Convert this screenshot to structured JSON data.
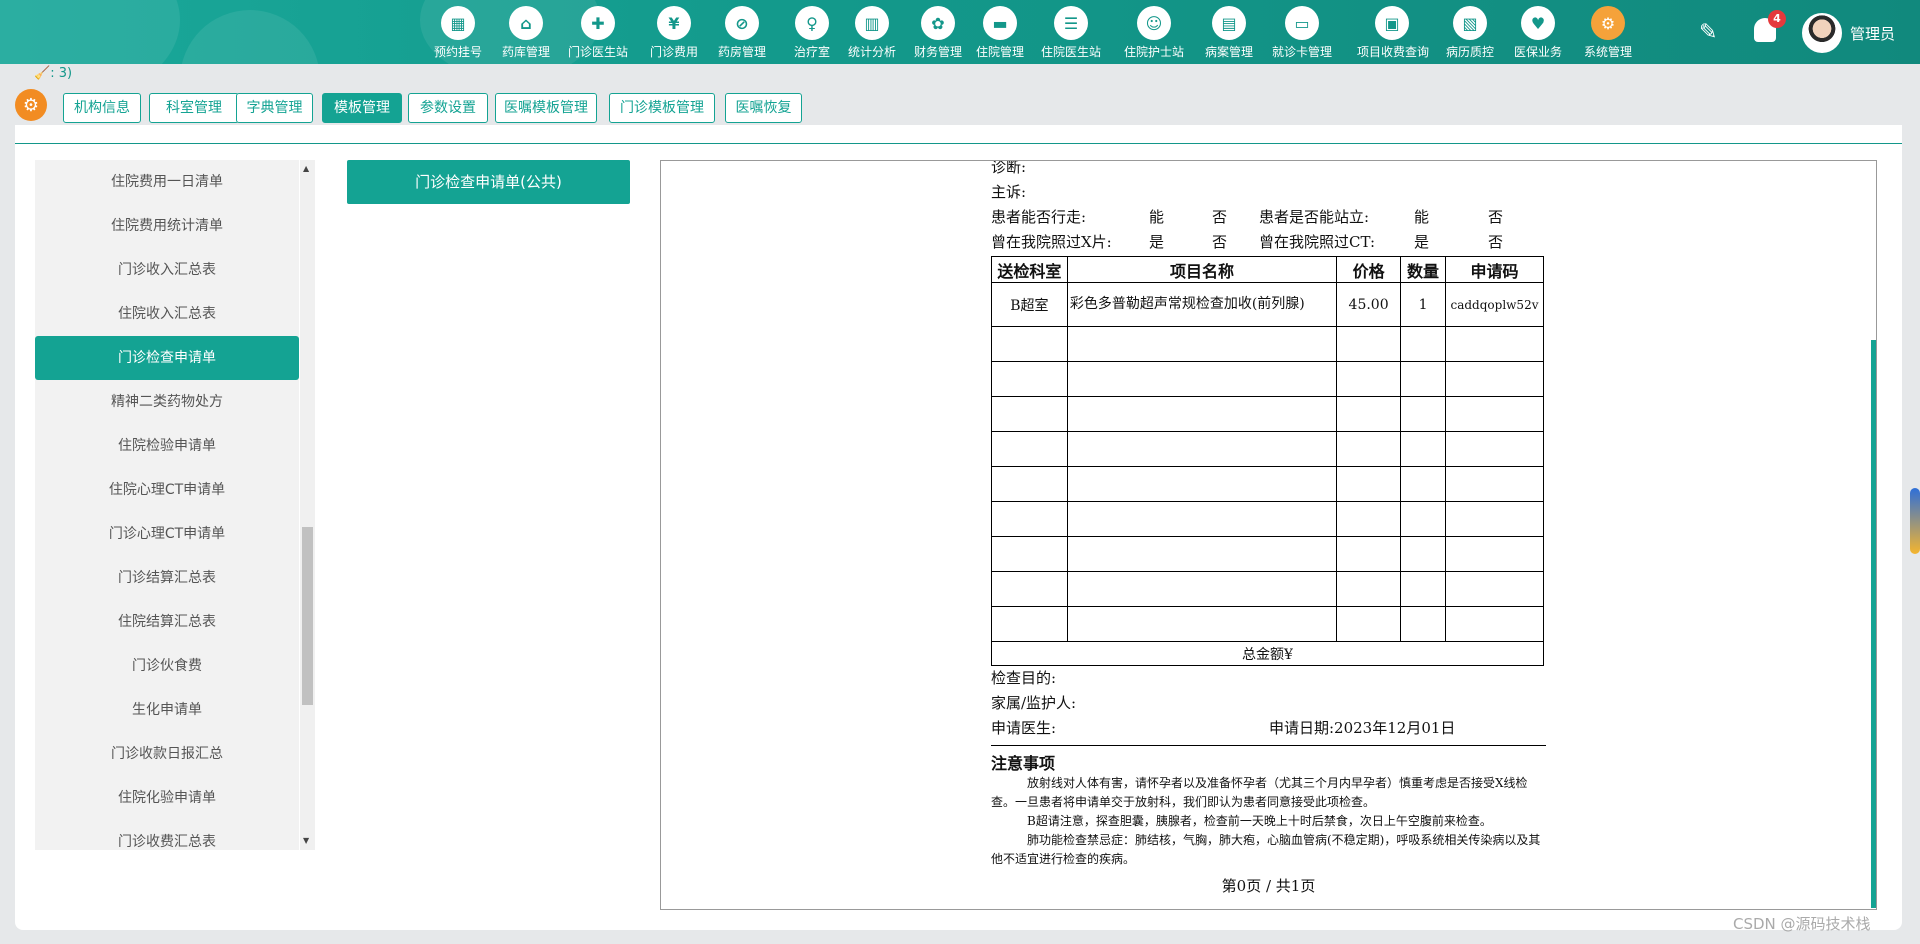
{
  "nav": {
    "items": [
      {
        "label": "预约挂号",
        "icon": "calendar-icon"
      },
      {
        "label": "药库管理",
        "icon": "warehouse-icon"
      },
      {
        "label": "门诊医生站",
        "icon": "doctor-icon"
      },
      {
        "label": "门诊费用",
        "icon": "yuan-icon"
      },
      {
        "label": "药房管理",
        "icon": "pill-icon"
      },
      {
        "label": "治疗室",
        "icon": "nurse-icon"
      },
      {
        "label": "统计分析",
        "icon": "chart-icon"
      },
      {
        "label": "财务管理",
        "icon": "finance-icon"
      },
      {
        "label": "住院管理",
        "icon": "bed-icon"
      },
      {
        "label": "住院医生站",
        "icon": "inpatient-doctor-icon"
      },
      {
        "label": "住院护士站",
        "icon": "nurse-station-icon"
      },
      {
        "label": "病案管理",
        "icon": "record-icon"
      },
      {
        "label": "就诊卡管理",
        "icon": "card-icon"
      },
      {
        "label": "项目收费查询",
        "icon": "fee-query-icon"
      },
      {
        "label": "病历质控",
        "icon": "quality-icon"
      },
      {
        "label": "医保业务",
        "icon": "insurance-icon"
      },
      {
        "label": "系统管理",
        "icon": "settings-icon"
      }
    ],
    "notification_count": "4",
    "username": "管理员"
  },
  "crumb": ": 3)",
  "tabs": [
    "机构信息",
    "科室管理",
    "字典管理",
    "模板管理",
    "参数设置",
    "医嘱模板管理",
    "门诊模板管理",
    "医嘱恢复"
  ],
  "active_tab": "模板管理",
  "sidebar": {
    "items": [
      "住院费用一日清单",
      "住院费用统计清单",
      "门诊收入汇总表",
      "住院收入汇总表",
      "门诊检查申请单",
      "精神二类药物处方",
      "住院检验申请单",
      "住院心理CT申请单",
      "门诊心理CT申请单",
      "门诊结算汇总表",
      "住院结算汇总表",
      "门诊伙食费",
      "生化申请单",
      "门诊收款日报汇总",
      "住院化验申请单",
      "门诊收费汇总表"
    ],
    "active": "门诊检查申请单"
  },
  "template_button": "门诊检查申请单(公共)",
  "doc": {
    "diagnosis": "诊断:",
    "complaint": "主诉:",
    "walk_q": "患者能否行走:",
    "yes_can": "能",
    "no": "否",
    "stand_q": "患者是否能站立:",
    "xray_q": "曾在我院照过X片:",
    "yes": "是",
    "ct_q": "曾在我院照过CT:",
    "table": {
      "headers": [
        "送检科室",
        "项目名称",
        "价格",
        "数量",
        "申请码"
      ],
      "rows": [
        [
          "B超室",
          "彩色多普勒超声常规检查加收(前列腺)",
          "45.00",
          "1",
          "caddqoplw52v"
        ]
      ],
      "total_label": "总金额¥"
    },
    "purpose": "检查目的:",
    "guardian": "家属/监护人:",
    "doctor": "申请医生:",
    "apply_date": "申请日期:2023年12月01日",
    "notes_title": "注意事项",
    "notes": [
      "放射线对人体有害，请怀孕者以及准备怀孕者（尤其三个月内早孕者）慎重考虑是否接受X线检查。一旦患者将申请单交于放射科，我们即认为患者同意接受此项检查。",
      "B超请注意，探查胆囊，胰腺者，检查前一天晚上十时后禁食，次日上午空腹前来检查。",
      "肺功能检查禁忌症：肺结核，气胸，肺大疱，心脑血管病(不稳定期)，呼吸系统相关传染病以及其他不适宜进行检查的疾病。"
    ],
    "pager": "第0页    /    共1页"
  },
  "watermark": "CSDN @源码技术栈",
  "colors": {
    "accent": "#14a393",
    "badge": "#e4393c",
    "gear": "#f28c22"
  }
}
